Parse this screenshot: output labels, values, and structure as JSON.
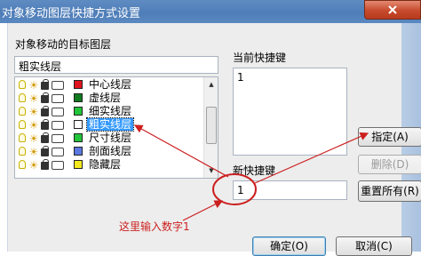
{
  "window": {
    "title": "对象移动图层快捷方式设置"
  },
  "target_layers": {
    "label": "对象移动的目标图层",
    "current_value": "粗实线层",
    "layers": [
      {
        "name": "中心线层",
        "color": "#e0141e",
        "selected": false
      },
      {
        "name": "虚线层",
        "color": "#0f7a1e",
        "selected": false
      },
      {
        "name": "细实线层",
        "color": "#22c43a",
        "selected": false
      },
      {
        "name": "粗实线层",
        "color": "#ffffff",
        "selected": true
      },
      {
        "name": "尺寸线层",
        "color": "#22c43a",
        "selected": false
      },
      {
        "name": "剖面线层",
        "color": "#5b77e0",
        "selected": false
      },
      {
        "name": "隐藏层",
        "color": "#f2ea1e",
        "selected": false
      }
    ]
  },
  "current_shortcut": {
    "label": "当前快捷键",
    "value": "1"
  },
  "new_shortcut": {
    "label": "新快捷键",
    "value": "1"
  },
  "buttons": {
    "assign": "指定(A)",
    "delete": "删除(D)",
    "reset_all": "重置所有(R)",
    "ok": "确定(O)",
    "cancel": "取消(C)"
  },
  "annotation": {
    "text": "这里输入数字1",
    "color": "#cc1f1f"
  }
}
